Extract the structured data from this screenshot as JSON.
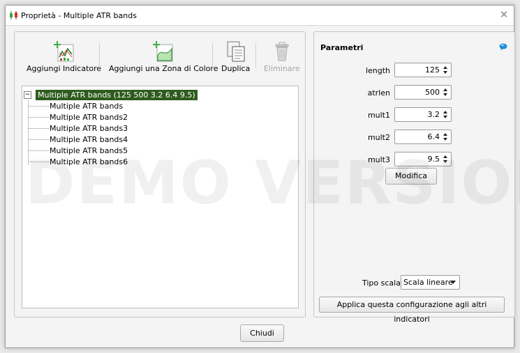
{
  "window": {
    "title": "Proprietà - Multiple ATR bands",
    "close_symbol": "✕"
  },
  "toolbar": {
    "add_indicator_label": "Aggiungi Indicatore",
    "add_zone_label": "Aggiungi una Zona di Colore",
    "duplicate_label": "Duplica",
    "delete_label": "Eliminare"
  },
  "tree": {
    "expander_symbol": "−",
    "root_label": "Multiple ATR bands (125 500 3.2 6.4 9.5)",
    "items": [
      "Multiple ATR bands",
      "Multiple ATR bands2",
      "Multiple ATR bands3",
      "Multiple ATR bands4",
      "Multiple ATR bands5",
      "Multiple ATR bands6"
    ]
  },
  "watermark": "DEMO VERSION",
  "params": {
    "title": "Parametri",
    "rows": [
      {
        "label": "length",
        "value": "125"
      },
      {
        "label": "atrlen",
        "value": "500"
      },
      {
        "label": "mult1",
        "value": "3.2"
      },
      {
        "label": "mult2",
        "value": "6.4"
      },
      {
        "label": "mult3",
        "value": "9.5"
      }
    ],
    "modify_label": "Modifica",
    "scale_label": "Tipo scala",
    "scale_value": "Scala lineare",
    "apply_label": "Applica questa configurazione agli altri indicatori"
  },
  "footer": {
    "close_label": "Chiudi"
  },
  "colors": {
    "selection": "#2e5c1f",
    "accent": "#1a8fd8"
  }
}
